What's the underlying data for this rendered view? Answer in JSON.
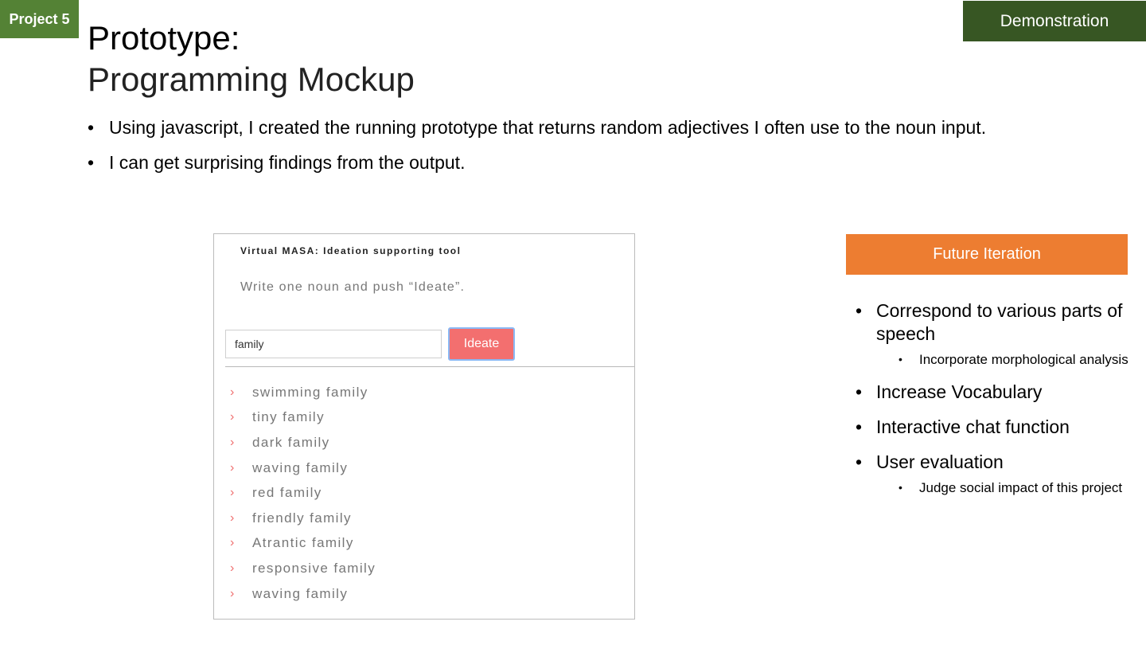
{
  "badges": {
    "project": "Project 5",
    "demo": "Demonstration"
  },
  "title": {
    "line1": "Prototype:",
    "line2": "Programming Mockup"
  },
  "bullets": [
    "Using javascript, I created the running prototype that returns random adjectives I often use to the noun input.",
    "I can get surprising findings from the output."
  ],
  "mockup": {
    "title": "Virtual MASA: Ideation supporting tool",
    "instruction": "Write one noun and push “Ideate”.",
    "input_value": "family",
    "button_label": "Ideate",
    "bullet_glyph": "›",
    "results": [
      "swimming family",
      "tiny family",
      "dark family",
      "waving family",
      "red family",
      "friendly family",
      "Atrantic family",
      "responsive family",
      "waving family"
    ]
  },
  "future": {
    "header": "Future Iteration",
    "items": [
      {
        "label": "Correspond to various parts of speech",
        "sub": [
          "Incorporate morphological analysis"
        ]
      },
      {
        "label": "Increase Vocabulary"
      },
      {
        "label": "Interactive chat function"
      },
      {
        "label": "User evaluation",
        "sub": [
          "Judge social impact of this project"
        ]
      }
    ]
  },
  "colors": {
    "project_badge": "#548235",
    "demo_badge": "#375623",
    "future_header": "#ed7d31",
    "ideate_button": "#f36f6f",
    "chevron": "#ef6f6f"
  }
}
